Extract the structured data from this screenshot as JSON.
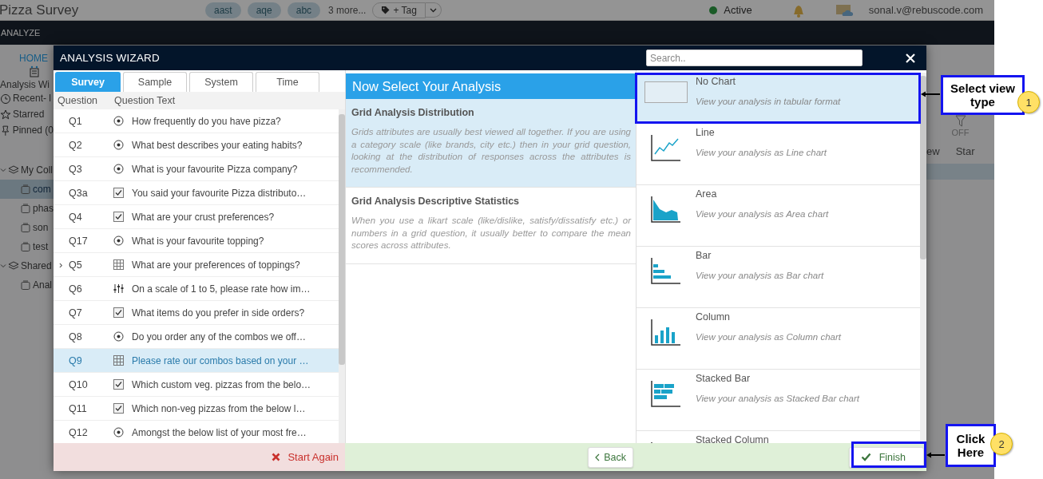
{
  "app": {
    "title": "Pizza Survey",
    "tags": [
      "aast",
      "aqe",
      "abc"
    ],
    "more_tags": "3 more...",
    "tag_button": "+ Tag",
    "status": "Active",
    "user_email": "sonal.v@rebuscode.com",
    "nav_item": "ANALYZE",
    "sidebar": {
      "home_tab": "HOME",
      "links": [
        {
          "kind": "wizard",
          "label": "Analysis Wi"
        },
        {
          "kind": "recent",
          "label": "Recent- l"
        },
        {
          "kind": "star",
          "label": "Starred"
        },
        {
          "kind": "pin",
          "label": "Pinned (0"
        }
      ],
      "tree": [
        {
          "label": "My Coll",
          "expanded": true,
          "selected": false,
          "children": [
            {
              "label": "com",
              "selected": true
            },
            {
              "label": "phas",
              "selected": false
            },
            {
              "label": "son",
              "selected": false
            },
            {
              "label": "test",
              "selected": false
            }
          ]
        },
        {
          "label": "Shared",
          "expanded": true,
          "selected": false,
          "children": [
            {
              "label": "Anal",
              "selected": false
            }
          ]
        }
      ]
    },
    "filter_toggle": "OFF",
    "table_columns": [
      "ew",
      "Star"
    ]
  },
  "wizard": {
    "title": "ANALYSIS WIZARD",
    "search": {
      "placeholder": "Search.."
    },
    "tabs": [
      {
        "label": "Survey",
        "selected": true
      },
      {
        "label": "Sample",
        "selected": false
      },
      {
        "label": "System",
        "selected": false
      },
      {
        "label": "Time",
        "selected": false
      }
    ],
    "columns": [
      "Question",
      "Question Text"
    ],
    "questions": [
      {
        "id": "Q1",
        "kind": "radio",
        "text": "How frequently do you have pizza?",
        "selected": false
      },
      {
        "id": "Q2",
        "kind": "radio",
        "text": "What best describes your eating habits?",
        "selected": false
      },
      {
        "id": "Q3",
        "kind": "radio",
        "text": "What is your favourite Pizza company?",
        "selected": false
      },
      {
        "id": "Q3a",
        "kind": "checkbox",
        "text": "You said your favourite Pizza distributo…",
        "selected": false
      },
      {
        "id": "Q4",
        "kind": "checkbox",
        "text": "What are your crust preferences?",
        "selected": false
      },
      {
        "id": "Q17",
        "kind": "radio",
        "text": "What is your favourite topping?",
        "selected": false
      },
      {
        "id": "Q5",
        "kind": "grid",
        "text": "What are your preferences of toppings?",
        "selected": false,
        "expander": "›"
      },
      {
        "id": "Q6",
        "kind": "scale",
        "text": "On a scale of 1 to 5, please rate how im…",
        "selected": false
      },
      {
        "id": "Q7",
        "kind": "checkbox",
        "text": "What items do you prefer in side orders?",
        "selected": false
      },
      {
        "id": "Q8",
        "kind": "radio",
        "text": "Do you order any of the combos we off…",
        "selected": false
      },
      {
        "id": "Q9",
        "kind": "grid",
        "text": "Please rate our combos based on your …",
        "selected": true
      },
      {
        "id": "Q10",
        "kind": "checkbox",
        "text": "Which custom veg. pizzas from the belo…",
        "selected": false
      },
      {
        "id": "Q11",
        "kind": "checkbox",
        "text": "Which non-veg pizzas from the below l…",
        "selected": false
      },
      {
        "id": "Q12",
        "kind": "radio",
        "text": "Amongst the below list of your most fre…",
        "selected": false
      }
    ],
    "start_again": "Start Again",
    "analysis_heading": "Now Select Your Analysis",
    "analyses": [
      {
        "title": "Grid Analysis Distribution",
        "description": "Grids attributes are usually best viewed all together. If you are using a category scale (like brands, city etc.) then in your grid question, looking at the distribution of responses across the attributes is recommended.",
        "selected": true
      },
      {
        "title": "Grid Analysis Descriptive Statistics",
        "description": "When you use a likart scale (like/dislike, satisfy/dissatisfy etc.) or numbers in a grid question, it usually better to compare the mean scores across attributes.",
        "selected": false
      }
    ],
    "back_button": "Back",
    "chart_types": [
      {
        "kind": "none",
        "title": "No Chart",
        "description": "View your analysis in tabular format",
        "selected": true
      },
      {
        "kind": "line",
        "title": "Line",
        "description": "View your analysis as Line chart",
        "selected": false
      },
      {
        "kind": "area",
        "title": "Area",
        "description": "View your analysis as Area chart",
        "selected": false
      },
      {
        "kind": "bar",
        "title": "Bar",
        "description": "View your analysis as Bar chart",
        "selected": false
      },
      {
        "kind": "column",
        "title": "Column",
        "description": "View your analysis as Column chart",
        "selected": false
      },
      {
        "kind": "stacked_bar",
        "title": "Stacked Bar",
        "description": "View your analysis as Stacked Bar chart",
        "selected": false
      },
      {
        "kind": "stacked_column",
        "title": "Stacked Column",
        "selected": false
      }
    ],
    "finish_button": "Finish"
  },
  "annotations": [
    {
      "text": "Select view type",
      "number": "1"
    },
    {
      "text": "Click Here",
      "number": "2"
    }
  ]
}
